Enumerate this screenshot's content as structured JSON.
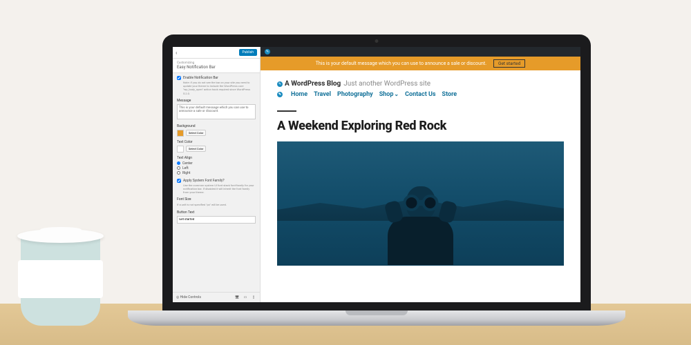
{
  "customizer": {
    "publish_label": "Publish",
    "back_icon": "‹",
    "crumb_sub": "Customizing",
    "crumb_title": "Easy Notification Bar",
    "enable": {
      "label": "Enable Notification Bar",
      "desc": "Note: if you do not see the bar on your site you need to update your theme to include the WordPress core \"wp_body_open\" action hook required since WordPress 5.2.0."
    },
    "message": {
      "label": "Message",
      "value": "This is your default message which you can use to announce a sale or discount."
    },
    "background": {
      "label": "Background",
      "button": "Select Color"
    },
    "text_color": {
      "label": "Text Color",
      "button": "Select Color"
    },
    "text_align": {
      "label": "Text Align",
      "options": [
        "Center",
        "Left",
        "Right"
      ]
    },
    "system_font": {
      "label": "Apply System Font Family?",
      "desc": "Use the common system UI font stack font-family for your notification bar. If disabled it will inherit the font family from your theme."
    },
    "font_size": {
      "label": "Font Size",
      "desc": "If a unit is not specified \"px\" will be used."
    },
    "button_text": {
      "label": "Button Text",
      "value": "Get started"
    },
    "hide_controls": "Hide Controls"
  },
  "preview": {
    "notification": {
      "message": "This is your default message which you can use to announce a sale or discount.",
      "button": "Get started"
    },
    "site": {
      "title": "A WordPress Blog",
      "tagline": "Just another WordPress site"
    },
    "menu": [
      "Home",
      "Travel",
      "Photography",
      "Shop",
      "Contact Us",
      "Store"
    ],
    "post_title": "A Weekend Exploring Red Rock"
  }
}
